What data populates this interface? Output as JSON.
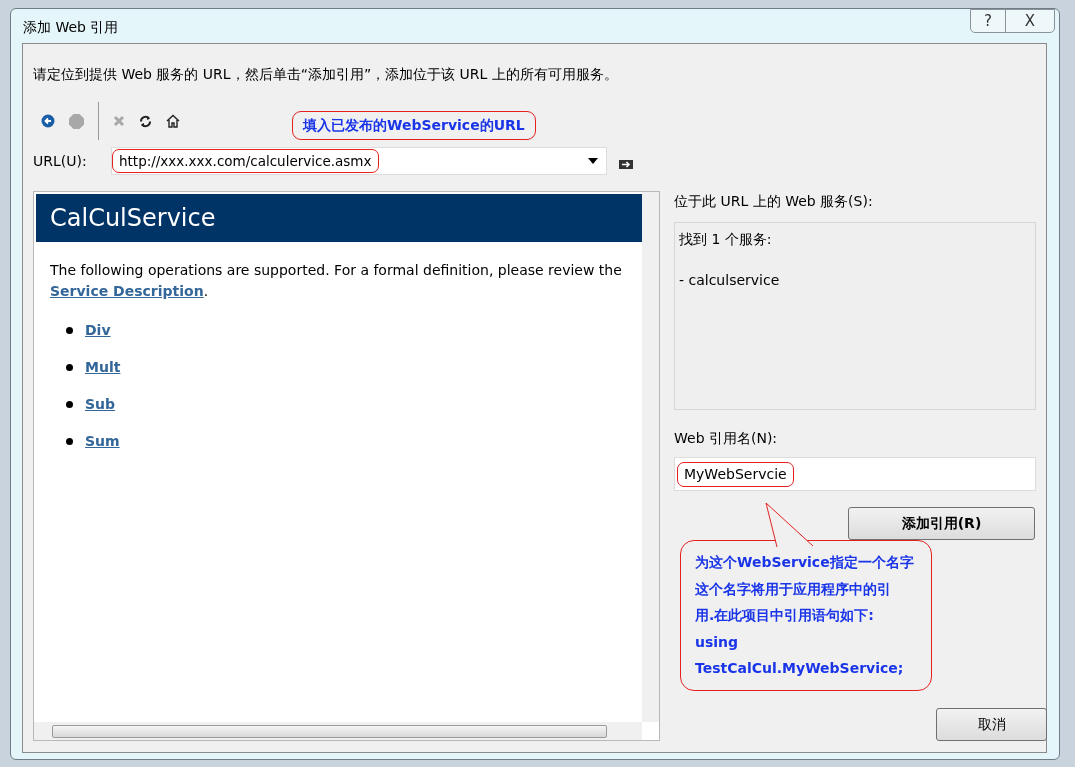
{
  "window": {
    "title": "添加 Web 引用",
    "help": "?",
    "close": "X"
  },
  "instruction": "请定位到提供 Web 服务的 URL，然后单击“添加引用”，添加位于该 URL 上的所有可用服务。",
  "toolbar": [
    {
      "kind": "back",
      "disabled": false
    },
    {
      "kind": "stop",
      "disabled": true
    },
    {
      "kind": "sep"
    },
    {
      "kind": "cancel",
      "disabled": true
    },
    {
      "kind": "refresh",
      "disabled": false
    },
    {
      "kind": "home",
      "disabled": false
    }
  ],
  "url": {
    "label": "URL(U):",
    "value": "http://xxx.xxx.com/calculervice.asmx"
  },
  "browser": {
    "heading": "CalCulService",
    "intro": "The following operations are supported. For a formal definition, please review the ",
    "intro_link": "Service Description",
    "intro_end": ".",
    "operations": [
      "Div",
      "Mult",
      "Sub",
      "Sum"
    ]
  },
  "services": {
    "label": "位于此 URL 上的 Web 服务(S):",
    "lines": [
      "找到 1 个服务:",
      "- calculservice"
    ]
  },
  "reference_name": {
    "label": "Web 引用名(N):",
    "value": "MyWebServcie"
  },
  "add_button": "添加引用(R)",
  "cancel_button": "取消",
  "callouts": [
    {
      "kind": "url",
      "text": "填入已发布的WebService的URL"
    },
    {
      "kind": "name",
      "lines": [
        "为这个WebService指定一个名字",
        "这个名字将用于应用程序中的引",
        "用.在此项目中引用语句如下:",
        "using TestCalCul.MyWebService;"
      ]
    }
  ]
}
